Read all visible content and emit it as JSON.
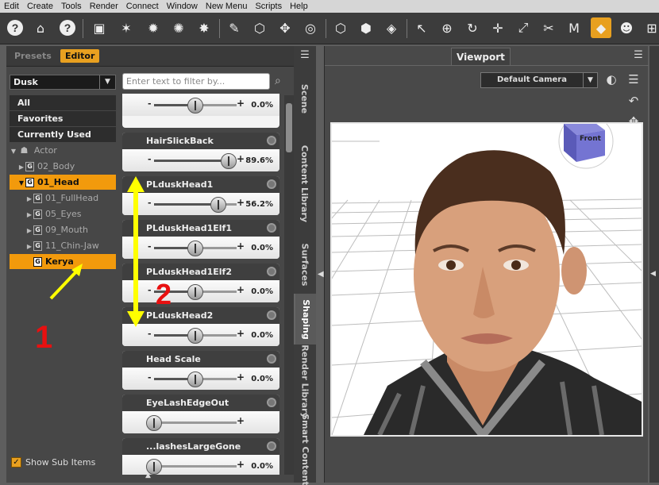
{
  "menu": [
    "Edit",
    "Create",
    "Tools",
    "Render",
    "Connect",
    "Window",
    "New Menu",
    "Scripts",
    "Help"
  ],
  "pane_tabs": {
    "presets": "Presets",
    "editor": "Editor"
  },
  "figure_select": "Dusk",
  "tree": {
    "all": "All",
    "favorites": "Favorites",
    "currently_used": "Currently Used",
    "actor": "Actor",
    "items": [
      {
        "label": "02_Body",
        "indent": 1,
        "expand": "▶",
        "selected": false
      },
      {
        "label": "01_Head",
        "indent": 1,
        "expand": "▼",
        "selected": true
      },
      {
        "label": "01_FullHead",
        "indent": 2,
        "expand": "▶",
        "selected": false
      },
      {
        "label": "05_Eyes",
        "indent": 2,
        "expand": "▶",
        "selected": false
      },
      {
        "label": "09_Mouth",
        "indent": 2,
        "expand": "▶",
        "selected": false
      },
      {
        "label": "11_Chin-Jaw",
        "indent": 2,
        "expand": "▶",
        "selected": false
      },
      {
        "label": "Kerya",
        "indent": 2,
        "expand": "",
        "selected": true
      }
    ],
    "group_glyph": "G"
  },
  "show_sub_items": "Show Sub Items",
  "filter_placeholder": "Enter text to filter by...",
  "properties": [
    {
      "name": "",
      "value": "0.0%",
      "fraction": 0.5
    },
    {
      "name": "HairSlickBack",
      "value": "89.6%",
      "fraction": 0.9
    },
    {
      "name": "PLduskHead1",
      "value": "56.2%",
      "fraction": 0.78
    },
    {
      "name": "PLduskHead1Elf1",
      "value": "0.0%",
      "fraction": 0.5
    },
    {
      "name": "PLduskHead1Elf2",
      "value": "0.0%",
      "fraction": 0.5
    },
    {
      "name": "PLduskHead2",
      "value": "0.0%",
      "fraction": 0.5
    },
    {
      "name": "Head Scale",
      "value": "0.0%",
      "fraction": 0.5
    },
    {
      "name": "EyeLashEdgeOut",
      "value": "",
      "fraction": 0.0
    },
    {
      "name": "...lashesLargeGone",
      "value": "0.0%",
      "fraction": 0.0
    }
  ],
  "side_tabs": [
    "Scene",
    "Content Library",
    "Surfaces",
    "Shaping",
    "Render Library",
    "Smart Content"
  ],
  "viewport": {
    "tab": "Viewport",
    "camera": "Default Camera",
    "cube_label": "Front"
  },
  "annotations": {
    "label1": "1",
    "label2": "2"
  },
  "colors": {
    "accent": "#e8a020",
    "selected": "#f29a0c",
    "annotation_red": "#e81010",
    "annotation_yellow": "#ffff00"
  }
}
